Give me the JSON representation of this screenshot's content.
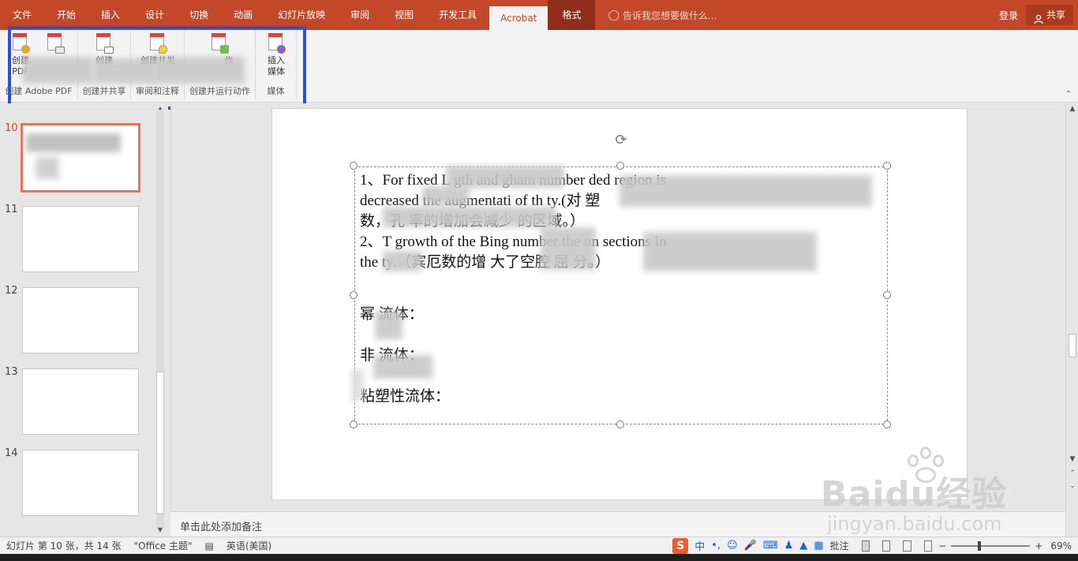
{
  "menubar": {
    "items": [
      "文件",
      "开始",
      "插入",
      "设计",
      "切换",
      "动画",
      "幻灯片放映",
      "审阅",
      "视图",
      "开发工具",
      "Acrobat",
      "格式"
    ],
    "active": "Acrobat",
    "tellme": "告诉我您想要做什么...",
    "login": "登录",
    "share": "共享"
  },
  "ribbon": {
    "buttons": [
      {
        "label": "创建\nPDF"
      },
      {
        "label": ""
      },
      {
        "label": "创建"
      },
      {
        "label": "创建并发"
      },
      {
        "label": "作"
      },
      {
        "label": "插入\n媒体"
      }
    ],
    "groups": [
      "创建 Adobe PDF",
      "创建并共享",
      "审阅和注释",
      "创建并运行动作",
      "媒体"
    ]
  },
  "thumbnails": {
    "numbers": [
      "10",
      "11",
      "12",
      "13",
      "14"
    ],
    "active": "10"
  },
  "slide": {
    "lines": [
      "1、For fixed L       gth and       gham number       ded region is",
      "decreased       the augmentati  of th       ty.(对              塑",
      "数，孔      率的增加会减少        的区域。）",
      "2、T   growth of the Bing    number         the un         sections in",
      "the     ty.（宾厄数的增        大了空腔     屈       分。）",
      "",
      "幂      流体：",
      "",
      "非          流体：",
      "",
      "粘塑性流体："
    ]
  },
  "notes": {
    "placeholder": "单击此处添加备注"
  },
  "status": {
    "slide_info": "幻灯片 第 10 张，共 14 张",
    "theme": "\"Office 主题\"",
    "language": "英语(美国)",
    "comments": "批注",
    "zoom": "69%"
  },
  "watermark": {
    "brand": "Baidu经验",
    "url": "jingyan.baidu.com"
  },
  "colors": {
    "menubar": "#c34729",
    "highlight": "#2f4fd4",
    "active_thumb": "#e8735a"
  }
}
